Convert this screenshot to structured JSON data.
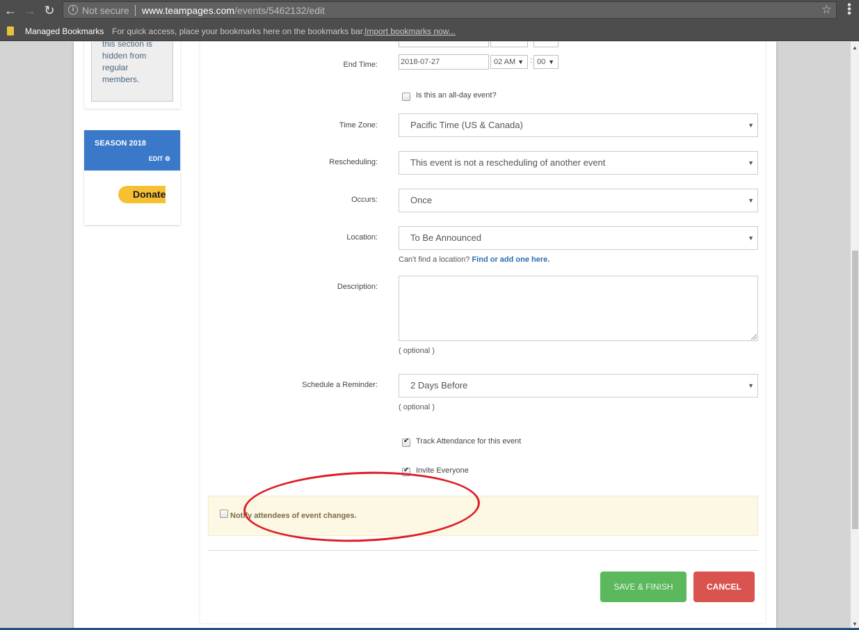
{
  "browser": {
    "security_label": "Not secure",
    "url_host": "www.teampages.com",
    "url_path": "/events/5462132/edit",
    "bookmarks_bar": {
      "folder": "Managed Bookmarks",
      "hint": "For quick access, place your bookmarks here on the bookmarks bar.",
      "import_link": "Import bookmarks now..."
    },
    "icons": {
      "back": "←",
      "forward": "→",
      "reload": "↻",
      "info": "i",
      "star": "☆",
      "menu": "⋮"
    }
  },
  "sidebar": {
    "note_text": "this section is hidden from regular members.",
    "season": {
      "title": "SEASON 2018",
      "edit_label": "EDIT",
      "edit_icon": "⚙"
    },
    "donate_label": "Donate"
  },
  "form": {
    "end_time": {
      "label": "End Time:",
      "date": "2018-07-27",
      "hour": "02 AM",
      "minute": "00",
      "separator": ":"
    },
    "all_day": {
      "label": "Is this an all-day event?",
      "checked": false
    },
    "time_zone": {
      "label": "Time Zone:",
      "value": "Pacific Time (US & Canada)"
    },
    "rescheduling": {
      "label": "Rescheduling:",
      "value": "This event is not a rescheduling of another event"
    },
    "occurs": {
      "label": "Occurs:",
      "value": "Once"
    },
    "location": {
      "label": "Location:",
      "value": "To Be Announced",
      "helper_text": "Can't find a location?",
      "helper_link": "Find or add one here."
    },
    "description": {
      "label": "Description:",
      "value": "",
      "hint": "( optional )"
    },
    "reminder": {
      "label": "Schedule a Reminder:",
      "value": "2 Days Before",
      "hint": "( optional )"
    },
    "track_attendance": {
      "label": "Track Attendance for this event",
      "checked": true
    },
    "invite_everyone": {
      "label": "Invite Everyone",
      "checked": true
    },
    "notify": {
      "label": "Notify attendees of event changes.",
      "checked": false
    },
    "dropdown_arrow": "▼",
    "buttons": {
      "save": "SAVE & FINISH",
      "cancel": "CANCEL"
    }
  },
  "colors": {
    "season_header": "#3a78c9",
    "save_button": "#5cb85c",
    "cancel_button": "#d9534f",
    "notify_box": "#fcf8e3",
    "annotation": "#dd1c26",
    "link": "#2a6db0"
  }
}
